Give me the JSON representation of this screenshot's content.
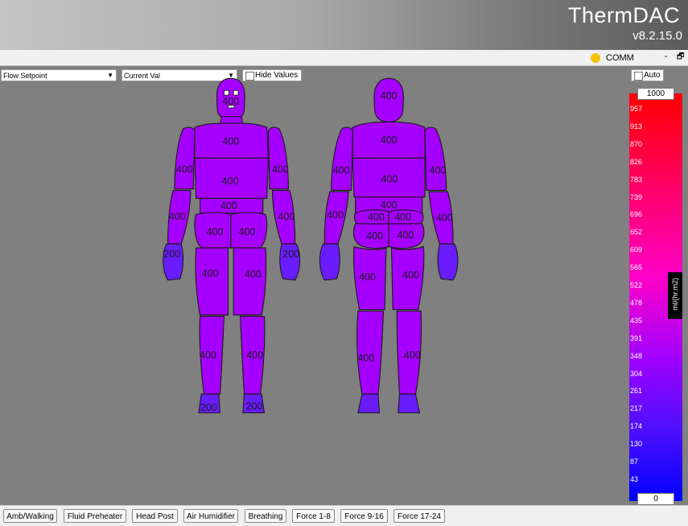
{
  "app": {
    "title": "ThermDAC",
    "version": "v8.2.15.0"
  },
  "status": {
    "comm_label": "COMM",
    "comm_color": "#f5c400",
    "minimize": "-",
    "restore": "🗗"
  },
  "controls": {
    "setpoint_select": "Flow Setpoint",
    "value_select": "Current Val",
    "hide_values_label": "Hide Values",
    "auto_label": "Auto"
  },
  "legend": {
    "max": "1000",
    "min": "0",
    "unit": "ml/(hr.m2)",
    "ticks": [
      "957",
      "913",
      "870",
      "826",
      "783",
      "739",
      "696",
      "652",
      "609",
      "565",
      "522",
      "478",
      "435",
      "391",
      "348",
      "304",
      "261",
      "217",
      "174",
      "130",
      "87",
      "43"
    ],
    "colors": {
      "high": "#ff0000",
      "mid": "#ff00c8",
      "low_mid": "#a000ff",
      "low": "#0000ff"
    }
  },
  "front": {
    "head": "400",
    "chest": "400",
    "abdomen": "400",
    "waist": "400",
    "left_upper_arm": "400",
    "right_upper_arm": "400",
    "left_forearm": "400",
    "right_forearm": "400",
    "left_hand": "200",
    "right_hand": "200",
    "left_hip": "400",
    "right_hip": "400",
    "left_thigh": "400",
    "right_thigh": "400",
    "left_calf": "400",
    "right_calf": "400",
    "left_foot": "200",
    "right_foot": "200"
  },
  "back": {
    "head": "400",
    "upper_back": "400",
    "mid_back": "400",
    "lower_back": "400",
    "left_upper_arm": "400",
    "right_upper_arm": "400",
    "left_forearm": "400",
    "right_forearm": "400",
    "left_upper_buttock": "400",
    "right_upper_buttock": "400",
    "left_buttock": "400",
    "right_buttock": "400",
    "left_thigh": "400",
    "right_thigh": "400",
    "left_calf": "400",
    "right_calf": "400"
  },
  "zone_colors": {
    "body": "#a500ff",
    "extremity": "#6a1cff",
    "outline": "#1a1a1a"
  },
  "bottom_tabs": [
    "Amb/Walking",
    "Fluid Preheater",
    "Head Post",
    "Air Humidifier",
    "Breathing",
    "Force 1-8",
    "Force 9-16",
    "Force 17-24"
  ]
}
